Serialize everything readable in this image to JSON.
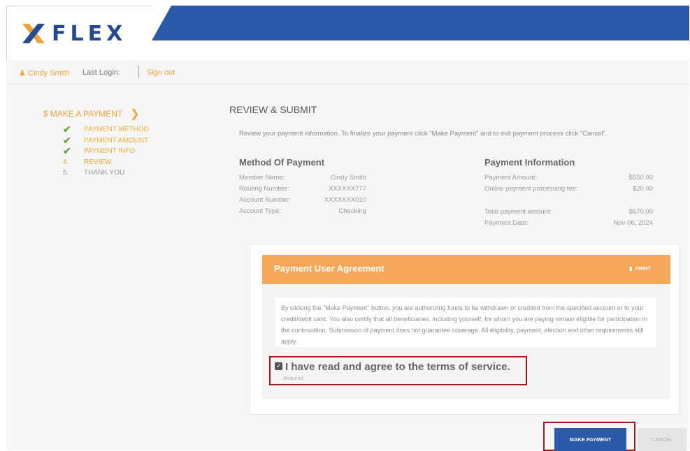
{
  "brand": {
    "name": "FLEX",
    "blue": "#2d5aa8",
    "orange": "#f0a23b",
    "accent_orange": "#f6a85a",
    "red_highlight": "#a3181b"
  },
  "userbar": {
    "user": "Cindy Smith",
    "last_login": "Last Login:",
    "sign_out": "Sign out"
  },
  "sidebar": {
    "title": "MAKE A PAYMENT",
    "steps": [
      {
        "mark": "✔",
        "label": "PAYMENT METHOD",
        "state": "done"
      },
      {
        "mark": "✔",
        "label": "PAYMENT AMOUNT",
        "state": "done"
      },
      {
        "mark": "✔",
        "label": "PAYMENT INFO",
        "state": "done"
      },
      {
        "mark": "4.",
        "label": "REVIEW",
        "state": "current"
      },
      {
        "mark": "5.",
        "label": "THANK YOU",
        "state": "future"
      }
    ]
  },
  "main": {
    "title": "REVIEW & SUBMIT",
    "instructions": "Review your payment information. To finalize your payment click \"Make Payment\" and to exit payment process click \"Cancel\".",
    "method": {
      "heading": "Method Of Payment",
      "rows": [
        {
          "label": "Member Name:",
          "value": "Cindy Smith"
        },
        {
          "label": "Routing Number:",
          "value": "XXXXXX777"
        },
        {
          "label": "Account Number:",
          "value": "XXXXXXX010"
        },
        {
          "label": "Account Type:",
          "value": "Checking"
        }
      ]
    },
    "payment_info": {
      "heading": "Payment Information",
      "rows": [
        {
          "label": "Payment Amount:",
          "value": "$550.00"
        },
        {
          "label": "Online payment processing fee:",
          "value": "$20.00"
        }
      ],
      "rows2": [
        {
          "label": "Total payment amount:",
          "value": "$570.00"
        },
        {
          "label": "Payment Date:",
          "value": "Nov 06, 2024"
        }
      ]
    },
    "agreement": {
      "title": "Payment User Agreement",
      "print": "PRINT",
      "text": "By clicking the \"Make Payment\" button, you are authorizing funds to be withdrawn or credited from the specified account or to your credit/debit card. You also certify that all beneficiaries, including yourself, for whom you are paying remain eligible for participation in the continuation. Submission of payment does not guarantee coverage. All eligibility, payment, election and other requirements still apply.",
      "tos_label": "I have read and agree to the terms of service.",
      "required": "Required",
      "tos_checked": true
    },
    "buttons": {
      "make_payment": "MAKE PAYMENT",
      "cancel": "CANCEL"
    }
  }
}
